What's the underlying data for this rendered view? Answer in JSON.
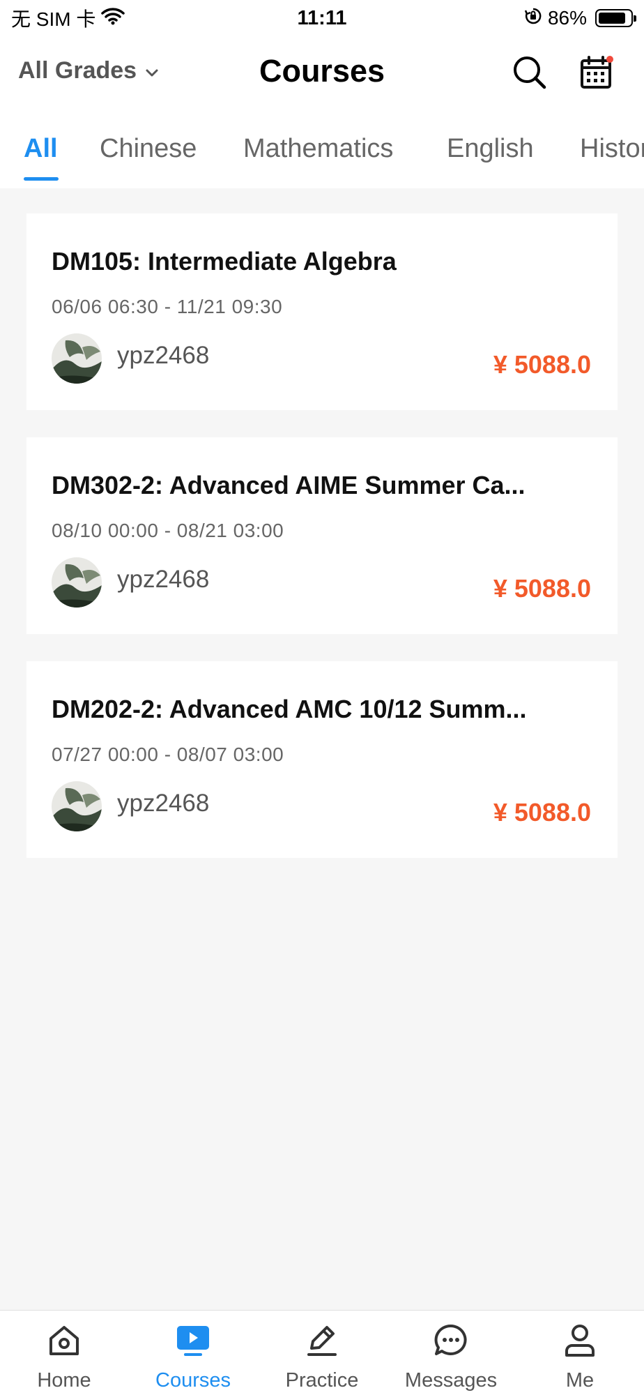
{
  "status_bar": {
    "carrier": "无 SIM 卡",
    "time": "11:11",
    "battery": "86%",
    "battery_level": 0.86
  },
  "header": {
    "grade_filter": "All Grades",
    "title": "Courses"
  },
  "tabs": [
    {
      "label": "All",
      "active": true
    },
    {
      "label": "Chinese",
      "active": false
    },
    {
      "label": "Mathematics",
      "active": false
    },
    {
      "label": "English",
      "active": false
    },
    {
      "label": "History",
      "active": false
    }
  ],
  "courses": [
    {
      "title": "DM105: Intermediate Algebra",
      "dates": "06/06 06:30 - 11/21 09:30",
      "teacher": "ypz2468",
      "price": "¥ 5088.0"
    },
    {
      "title": "DM302-2: Advanced AIME Summer Ca...",
      "dates": "08/10 00:00 - 08/21 03:00",
      "teacher": "ypz2468",
      "price": "¥ 5088.0"
    },
    {
      "title": "DM202-2: Advanced AMC 10/12 Summ...",
      "dates": "07/27 00:00 - 08/07 03:00",
      "teacher": "ypz2468",
      "price": "¥ 5088.0"
    }
  ],
  "tab_bar": [
    {
      "label": "Home",
      "icon": "home-icon",
      "active": false
    },
    {
      "label": "Courses",
      "icon": "play-video-icon",
      "active": true
    },
    {
      "label": "Practice",
      "icon": "pencil-icon",
      "active": false
    },
    {
      "label": "Messages",
      "icon": "chat-bubble-icon",
      "active": false
    },
    {
      "label": "Me",
      "icon": "user-icon",
      "active": false
    }
  ],
  "colors": {
    "accent": "#1e8ef0",
    "price": "#f25a2a",
    "notification_dot": "#f04a3c"
  }
}
